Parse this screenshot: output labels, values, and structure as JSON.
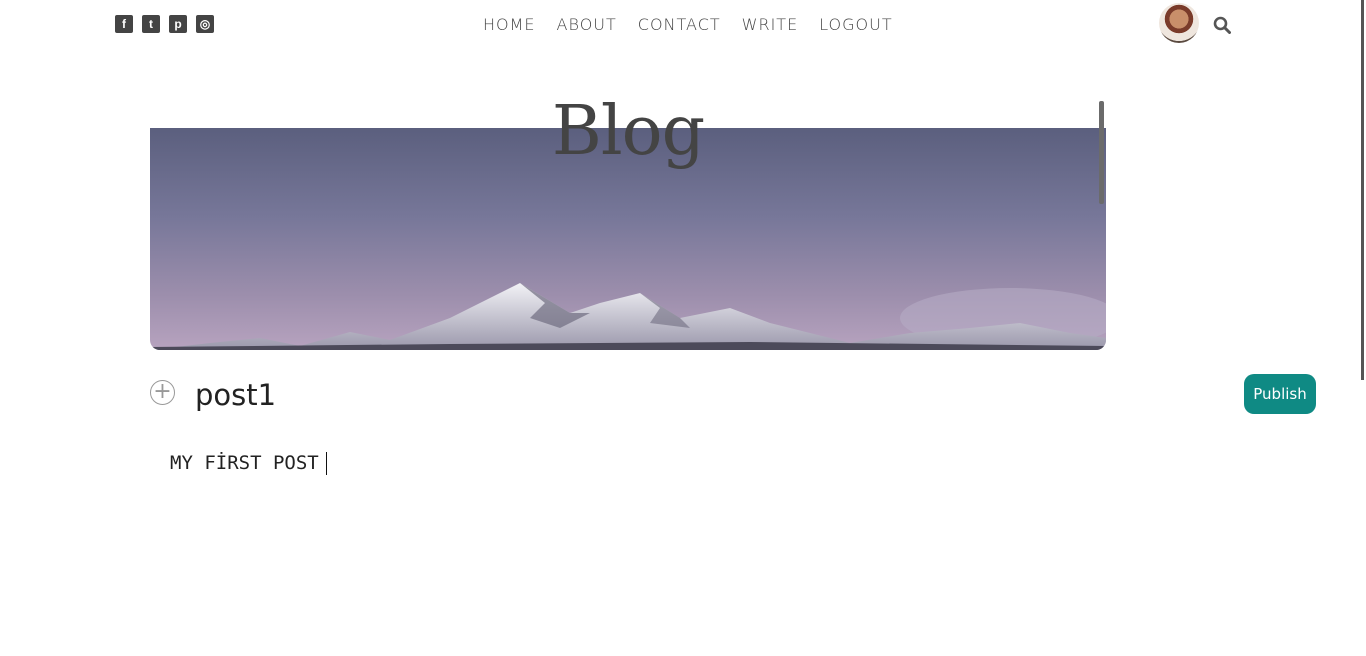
{
  "social": {
    "icons": [
      "facebook-icon",
      "twitter-icon",
      "pinterest-icon",
      "instagram-icon"
    ],
    "glyphs": [
      "f",
      "t",
      "p",
      "◎"
    ]
  },
  "nav": {
    "items": [
      "HOME",
      "ABOUT",
      "CONTACT",
      "WRITE",
      "LOGOUT"
    ]
  },
  "header": {
    "avatar_icon": "user-avatar",
    "search_icon": "search-icon"
  },
  "hero": {
    "title": "Blog"
  },
  "editor": {
    "title_value": "post1",
    "body_value": "MY FİRST POST",
    "add_symbol": "+",
    "publish_label": "Publish"
  },
  "colors": {
    "accent": "#0f8a84",
    "text": "#444444"
  }
}
